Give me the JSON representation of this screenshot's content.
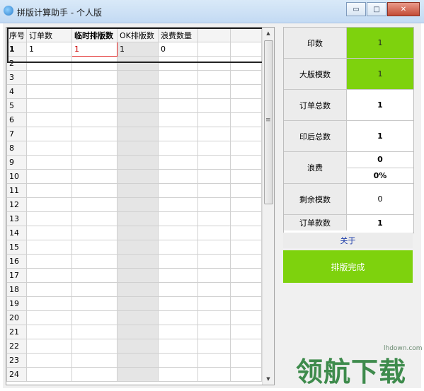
{
  "window": {
    "title": "拼版计算助手 - 个人版",
    "buttons": {
      "minimize": "▭",
      "maximize": "□",
      "close": "✕"
    }
  },
  "grid": {
    "headers": [
      "序号",
      "订单数",
      "临时排版数",
      "OK排版数",
      "浪费数量",
      "",
      ""
    ],
    "rows": [
      [
        "1",
        "1",
        "1",
        "1",
        "0",
        "",
        ""
      ],
      [
        "2",
        "",
        "",
        "",
        "",
        "",
        ""
      ],
      [
        "3",
        "",
        "",
        "",
        "",
        "",
        ""
      ],
      [
        "4",
        "",
        "",
        "",
        "",
        "",
        ""
      ],
      [
        "5",
        "",
        "",
        "",
        "",
        "",
        ""
      ],
      [
        "6",
        "",
        "",
        "",
        "",
        "",
        ""
      ],
      [
        "7",
        "",
        "",
        "",
        "",
        "",
        ""
      ],
      [
        "8",
        "",
        "",
        "",
        "",
        "",
        ""
      ],
      [
        "9",
        "",
        "",
        "",
        "",
        "",
        ""
      ],
      [
        "10",
        "",
        "",
        "",
        "",
        "",
        ""
      ],
      [
        "11",
        "",
        "",
        "",
        "",
        "",
        ""
      ],
      [
        "12",
        "",
        "",
        "",
        "",
        "",
        ""
      ],
      [
        "13",
        "",
        "",
        "",
        "",
        "",
        ""
      ],
      [
        "14",
        "",
        "",
        "",
        "",
        "",
        ""
      ],
      [
        "15",
        "",
        "",
        "",
        "",
        "",
        ""
      ],
      [
        "16",
        "",
        "",
        "",
        "",
        "",
        ""
      ],
      [
        "17",
        "",
        "",
        "",
        "",
        "",
        ""
      ],
      [
        "18",
        "",
        "",
        "",
        "",
        "",
        ""
      ],
      [
        "19",
        "",
        "",
        "",
        "",
        "",
        ""
      ],
      [
        "20",
        "",
        "",
        "",
        "",
        "",
        ""
      ],
      [
        "21",
        "",
        "",
        "",
        "",
        "",
        ""
      ],
      [
        "22",
        "",
        "",
        "",
        "",
        "",
        ""
      ],
      [
        "23",
        "",
        "",
        "",
        "",
        "",
        ""
      ],
      [
        "24",
        "",
        "",
        "",
        "",
        "",
        ""
      ]
    ]
  },
  "panel": {
    "print_count_label": "印数",
    "print_count_value": "1",
    "big_plate_label": "大版模数",
    "big_plate_value": "1",
    "order_total_label": "订单总数",
    "order_total_value": "1",
    "after_print_label": "印后总数",
    "after_print_value": "1",
    "waste_label": "浪费",
    "waste_value": "0",
    "waste_percent": "0%",
    "remaining_label": "剩余模数",
    "remaining_value": "0",
    "order_kinds_label": "订单款数",
    "order_kinds_value": "1"
  },
  "about_label": "关于",
  "done_label": "排版完成",
  "watermark": {
    "text": "领航下载",
    "url_text": "lhdown.com"
  },
  "colors": {
    "accent_green": "#7ed20d",
    "about_text": "#1a3aa8",
    "edit_border": "#e02020"
  }
}
